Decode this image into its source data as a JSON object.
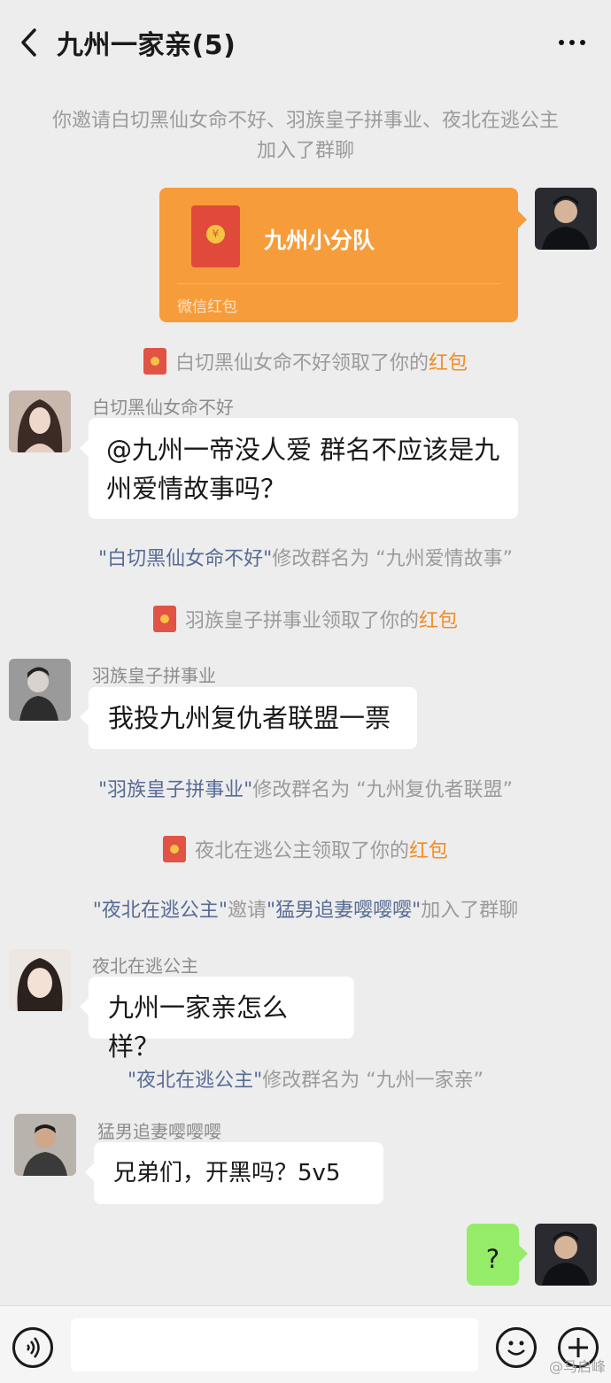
{
  "header": {
    "title": "九州一家亲(5)"
  },
  "messages": {
    "sys_invite": "你邀请白切黑仙女命不好、羽族皇子拼事业、夜北在逃公主加入了群聊",
    "red_packet": {
      "title": "九州小分队",
      "footer": "微信红包"
    },
    "rp_claim_1": {
      "name": "白切黑仙女命不好",
      "text": "领取了你的",
      "link": "红包"
    },
    "msg1": {
      "sender": "白切黑仙女命不好",
      "text": "@九州一帝没人爱  群名不应该是九州爱情故事吗？"
    },
    "rename_1": {
      "name": "\"白切黑仙女命不好\"",
      "text": "修改群名为 “九州爱情故事”"
    },
    "rp_claim_2": {
      "name": "羽族皇子拼事业",
      "text": "领取了你的",
      "link": "红包"
    },
    "msg2": {
      "sender": "羽族皇子拼事业",
      "text": "我投九州复仇者联盟一票"
    },
    "rename_2": {
      "name": "\"羽族皇子拼事业\"",
      "text": "修改群名为 “九州复仇者联盟”"
    },
    "rp_claim_3": {
      "name": "夜北在逃公主",
      "text": "领取了你的",
      "link": "红包"
    },
    "invite_2": {
      "name1": "\"夜北在逃公主\"",
      "mid": "邀请",
      "name2": "\"猛男追妻嘤嘤嘤\"",
      "end": "加入了群聊"
    },
    "msg3": {
      "sender": "夜北在逃公主",
      "text": "九州一家亲怎么样？"
    },
    "rename_3": {
      "name": "\"夜北在逃公主\"",
      "text": "修改群名为 “九州一家亲”"
    },
    "msg4": {
      "sender": "猛男追妻嘤嘤嘤",
      "text": "兄弟们，开黑吗？5v5"
    },
    "msg5": {
      "text": "?"
    }
  },
  "footer": {
    "watermark": "@马启峰"
  },
  "colors": {
    "background": "#ededed",
    "link": "#576b95",
    "red_packet": "#f79c3a",
    "self_bubble": "#95ec69"
  }
}
